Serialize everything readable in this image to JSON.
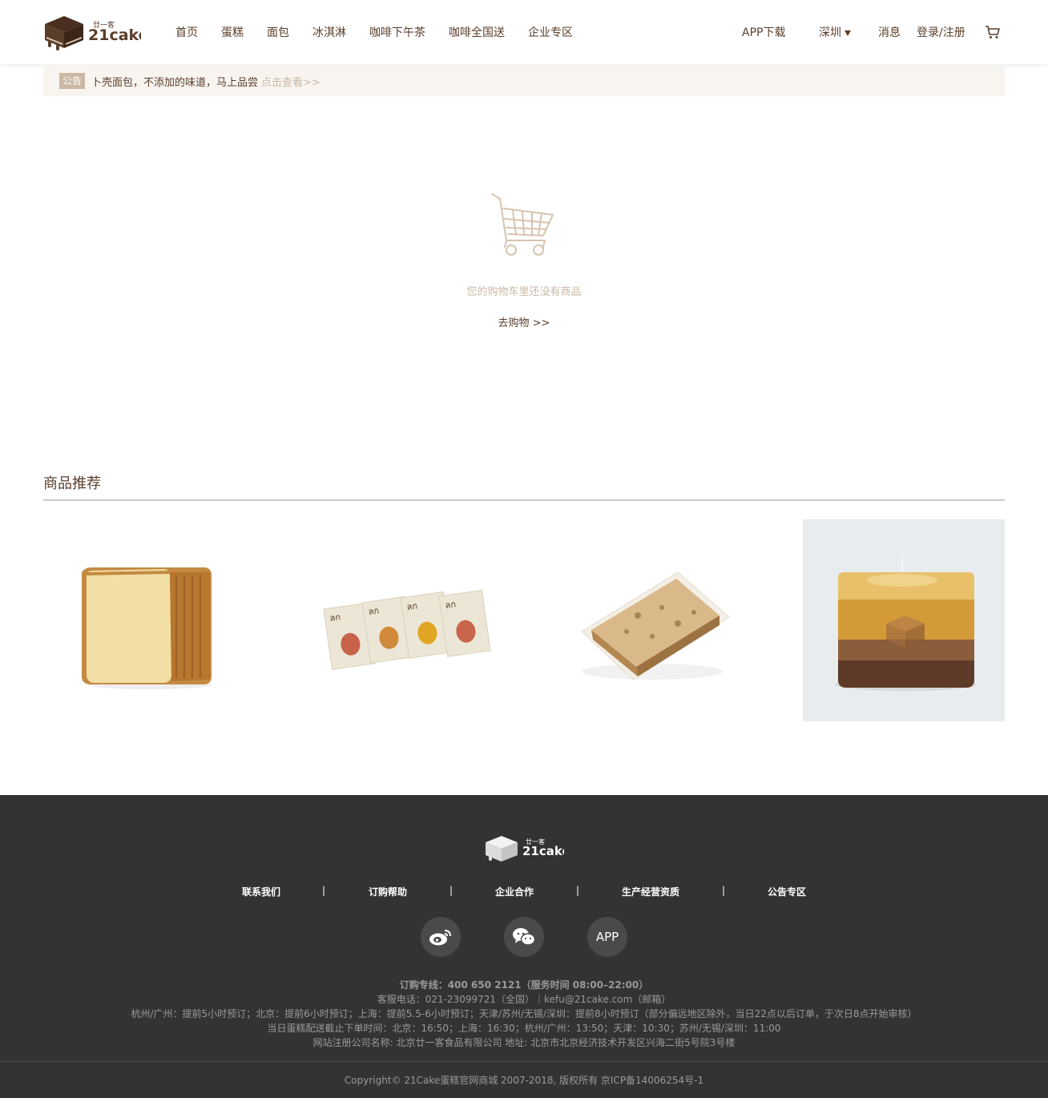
{
  "header": {
    "logo_text": "21cake",
    "logo_cn": "廿一客",
    "nav": [
      {
        "label": "首页"
      },
      {
        "label": "蛋糕"
      },
      {
        "label": "面包"
      },
      {
        "label": "冰淇淋"
      },
      {
        "label": "咖啡下午茶"
      },
      {
        "label": "咖啡全国送"
      },
      {
        "label": "企业专区"
      }
    ],
    "app_download": "APP下载",
    "city": "深圳",
    "messages": "消息",
    "login": "登录/注册",
    "cart_icon": "cart-icon"
  },
  "notice": {
    "badge": "公告",
    "text": "卜壳面包，不添加的味道，马上品尝",
    "link": "点击查看>>"
  },
  "empty_cart": {
    "icon": "empty-cart-icon",
    "message": "您的购物车里还没有商品",
    "go_shopping": "去购物 >>"
  },
  "recommendations": {
    "title": "商品推荐",
    "products": [
      {
        "name": "bread-product-image"
      },
      {
        "name": "coffee-drip-product-image"
      },
      {
        "name": "cake-slice-product-image"
      },
      {
        "name": "candle-product-image"
      }
    ]
  },
  "footer": {
    "logo_text": "21cake",
    "logo_cn": "廿一客",
    "links": [
      "联系我们",
      "订购帮助",
      "企业合作",
      "生产经营资质",
      "公告专区"
    ],
    "separator": "|",
    "social": [
      {
        "icon": "weibo-icon",
        "label": ""
      },
      {
        "icon": "wechat-icon",
        "label": ""
      },
      {
        "icon": "app-icon",
        "label": "APP"
      }
    ],
    "hotline": "订购专线：400 650 2121（服务时间 08:00–22:00）",
    "service": "客服电话：021-23099721（全国）｜kefu@21cake.com（邮箱）",
    "preorder": "杭州/广州：提前5小时预订；北京：提前6小时预订；上海：提前5.5-6小时预订；天津/苏州/无锡/深圳：提前8小时预订（部分偏远地区除外，当日22点以后订单，于次日8点开始审核）",
    "cutoff": "当日蛋糕配送截止下单时间：北京：16:50；上海：16:30；杭州/广州：13:50；天津：10:30；苏州/无锡/深圳：11:00",
    "company": "网站注册公司名称: 北京廿一客食品有限公司 地址: 北京市北京经济技术开发区兴海二街5号院3号楼",
    "copyright": "Copyright© 21Cake蛋糕官网商城 2007-2018, 版权所有 京ICP备14006254号-1"
  },
  "colors": {
    "brand_brown": "#5a3e2b",
    "accent_tan": "#cbb8a3",
    "footer_bg": "#333333",
    "notice_bg": "#f8f5f0"
  }
}
